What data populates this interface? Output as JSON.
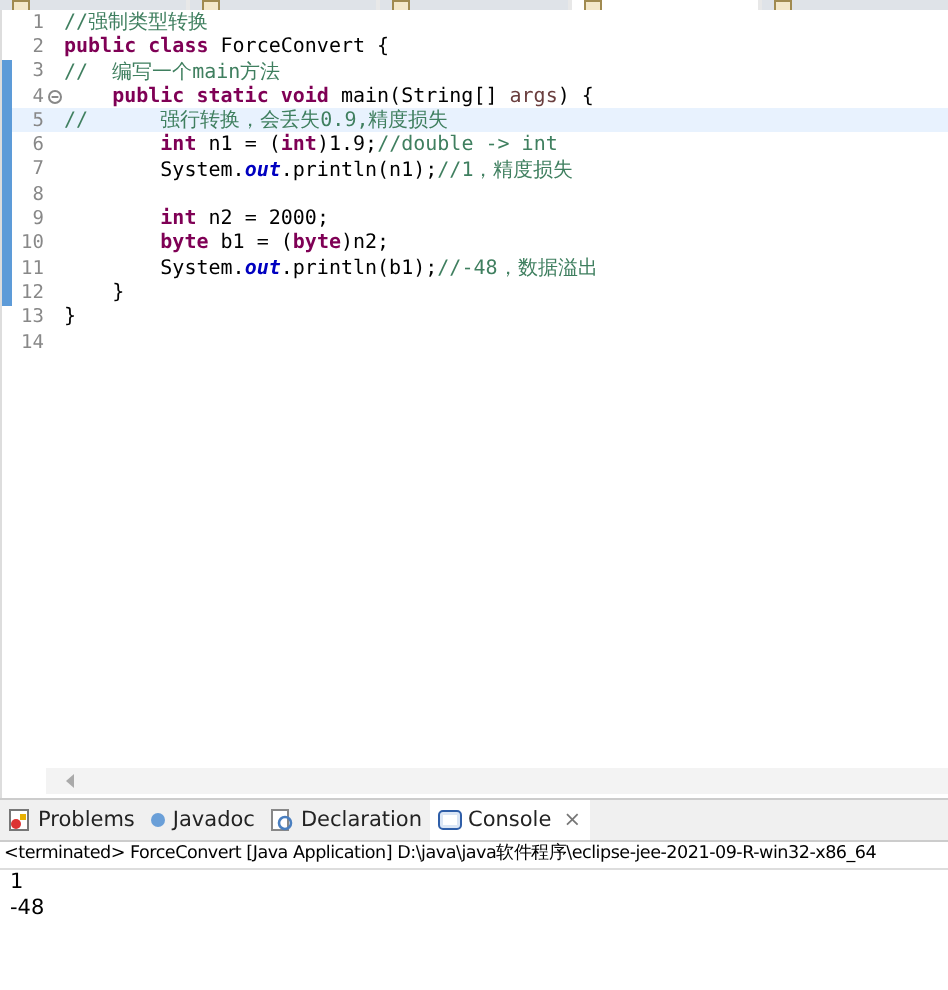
{
  "editor_tabs": [
    {
      "selected": false
    },
    {
      "selected": false
    },
    {
      "selected": false
    },
    {
      "selected": true
    },
    {
      "selected": false
    }
  ],
  "code_lines": [
    {
      "number": "1",
      "changed": false,
      "current": false,
      "fold": false,
      "segments": [
        {
          "kind": "comment",
          "text": "//强制类型转换"
        }
      ]
    },
    {
      "number": "2",
      "changed": false,
      "current": false,
      "fold": false,
      "segments": [
        {
          "kind": "keyword",
          "text": "public class"
        },
        {
          "kind": "plain",
          "text": " ForceConvert {"
        }
      ]
    },
    {
      "number": "3",
      "changed": true,
      "current": false,
      "fold": false,
      "segments": [
        {
          "kind": "comment",
          "text": "//  编写一个main方法"
        }
      ]
    },
    {
      "number": "4",
      "changed": true,
      "current": false,
      "fold": true,
      "segments": [
        {
          "kind": "keyword",
          "text": "    public static void"
        },
        {
          "kind": "plain",
          "text": " main(String[] "
        },
        {
          "kind": "param",
          "text": "args"
        },
        {
          "kind": "plain",
          "text": ") {"
        }
      ]
    },
    {
      "number": "5",
      "changed": true,
      "current": true,
      "fold": false,
      "segments": [
        {
          "kind": "comment",
          "text": "//      强行转换，会丢失0.9,精度损失"
        }
      ]
    },
    {
      "number": "6",
      "changed": true,
      "current": false,
      "fold": false,
      "segments": [
        {
          "kind": "keyword",
          "text": "        int"
        },
        {
          "kind": "plain",
          "text": " n1 = ("
        },
        {
          "kind": "keyword",
          "text": "int"
        },
        {
          "kind": "plain",
          "text": ")1.9;"
        },
        {
          "kind": "comment",
          "text": "//double -> int"
        }
      ]
    },
    {
      "number": "7",
      "changed": true,
      "current": false,
      "fold": false,
      "segments": [
        {
          "kind": "plain",
          "text": "        System."
        },
        {
          "kind": "field",
          "text": "out"
        },
        {
          "kind": "plain",
          "text": ".println(n1);"
        },
        {
          "kind": "comment",
          "text": "//1，精度损失"
        }
      ]
    },
    {
      "number": "8",
      "changed": true,
      "current": false,
      "fold": false
    },
    {
      "number": "9",
      "changed": true,
      "current": false,
      "fold": false,
      "segments": [
        {
          "kind": "keyword",
          "text": "        int"
        },
        {
          "kind": "plain",
          "text": " n2 = 2000;"
        }
      ]
    },
    {
      "number": "10",
      "changed": true,
      "current": false,
      "fold": false,
      "segments": [
        {
          "kind": "keyword",
          "text": "        byte"
        },
        {
          "kind": "plain",
          "text": " b1 = ("
        },
        {
          "kind": "keyword",
          "text": "byte"
        },
        {
          "kind": "plain",
          "text": ")n2;"
        }
      ]
    },
    {
      "number": "11",
      "changed": true,
      "current": false,
      "fold": false,
      "segments": [
        {
          "kind": "plain",
          "text": "        System."
        },
        {
          "kind": "field",
          "text": "out"
        },
        {
          "kind": "plain",
          "text": ".println(b1);"
        },
        {
          "kind": "comment",
          "text": "//-48，数据溢出"
        }
      ]
    },
    {
      "number": "12",
      "changed": true,
      "current": false,
      "fold": false,
      "segments": [
        {
          "kind": "plain",
          "text": "    }"
        }
      ]
    },
    {
      "number": "13",
      "changed": false,
      "current": false,
      "fold": false,
      "segments": [
        {
          "kind": "plain",
          "text": "}"
        }
      ]
    },
    {
      "number": "14",
      "changed": false,
      "current": false,
      "fold": false
    }
  ],
  "view_tabs": [
    {
      "kind": "problems",
      "label": "Problems",
      "selected": false,
      "closable": false
    },
    {
      "kind": "javadoc",
      "label": "Javadoc",
      "selected": false,
      "closable": false
    },
    {
      "kind": "declaration",
      "label": "Declaration",
      "selected": false,
      "closable": false
    },
    {
      "kind": "console",
      "label": "Console",
      "selected": true,
      "closable": true,
      "close": "×"
    }
  ],
  "console": {
    "header": "<terminated> ForceConvert [Java Application] D:\\java\\java软件程序\\eclipse-jee-2021-09-R-win32-x86_64",
    "output": [
      "1",
      "-48"
    ]
  }
}
